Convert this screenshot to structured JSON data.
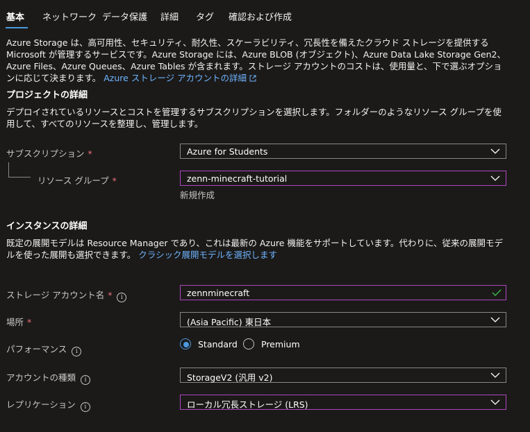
{
  "tabs": [
    "基本",
    "ネットワーク",
    "データ保護",
    "詳細",
    "タグ",
    "確認および作成"
  ],
  "intro": {
    "text": "Azure Storage は、高可用性、セキュリティ、耐久性、スケーラビリティ、冗長性を備えたクラウド ストレージを提供する Microsoft が管理するサービスです。Azure Storage には、Azure BLOB (オブジェクト)、Azure Data Lake Storage Gen2、Azure Files、Azure Queues、Azure Tables が含まれます。ストレージ アカウントのコストは、使用量と、下で選ぶオプションに応じて決まります。",
    "link": "Azure ストレージ アカウントの詳細"
  },
  "project": {
    "heading": "プロジェクトの詳細",
    "description": "デプロイされているリソースとコストを管理するサブスクリプションを選択します。フォルダーのようなリソース グループを使用して、すべてのリソースを整理し、管理します。",
    "subscription_label": "サブスクリプション",
    "subscription_value": "Azure for Students",
    "resource_group_label": "リソース グループ",
    "resource_group_value": "zenn-minecraft-tutorial",
    "create_new": "新規作成"
  },
  "instance": {
    "heading": "インスタンスの詳細",
    "description": "既定の展開モデルは Resource Manager であり、これは最新の Azure 機能をサポートしています。代わりに、従来の展開モデルを使った展開も選択できます。",
    "classic_link": "クラシック展開モデルを選択します",
    "account_name_label": "ストレージ アカウント名",
    "account_name_value": "zennminecraft",
    "location_label": "場所",
    "location_value": "(Asia Pacific) 東日本",
    "performance_label": "パフォーマンス",
    "performance_options": [
      "Standard",
      "Premium"
    ],
    "performance_selected": "Standard",
    "account_kind_label": "アカウントの種類",
    "account_kind_value": "StorageV2 (汎用 v2)",
    "replication_label": "レプリケーション",
    "replication_value": "ローカル冗長ストレージ (LRS)"
  },
  "required_mark": "*",
  "info_mark": "i",
  "colors": {
    "accent": "#4a9ae0",
    "link": "#6fb4ff",
    "required": "#f1707b",
    "focus_border": "#b146c2",
    "valid": "#3fb950"
  }
}
